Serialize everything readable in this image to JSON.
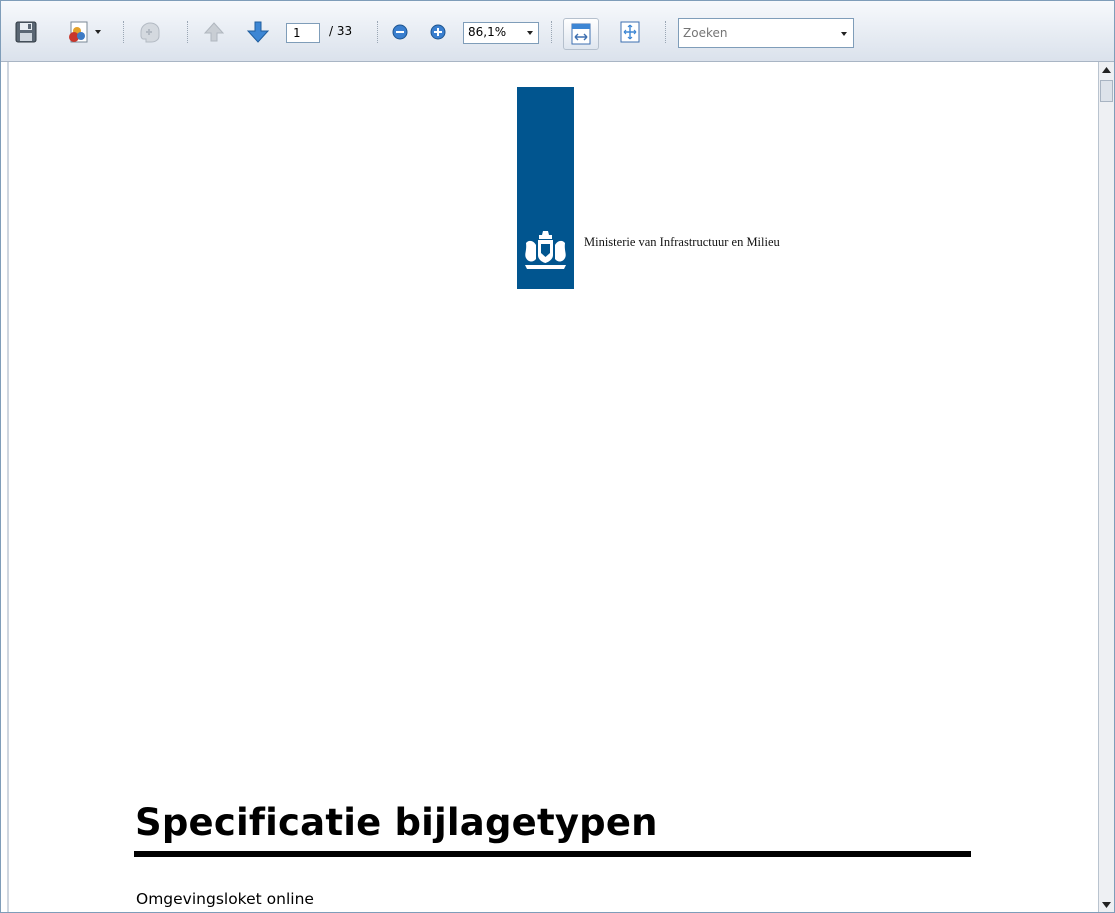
{
  "toolbar": {
    "icons": [
      "save-icon",
      "share-icon",
      "hand-tool-icon",
      "previous-page-icon",
      "next-page-icon",
      "zoom-out-icon",
      "zoom-in-icon",
      "fit-width-icon",
      "fit-page-icon",
      "dropdown-arrow-icon"
    ],
    "page_current": "1",
    "page_total": "/ 33",
    "zoom_value": "86,1%",
    "search_placeholder": "Zoeken"
  },
  "document": {
    "ministry_name": "Ministerie van Infrastructuur en Milieu",
    "title": "Specificatie bijlagetypen",
    "subtitle": "Omgevingsloket online"
  },
  "colors": {
    "logo_blue": "#01558f",
    "toolbar_bg": "#e7ecf3",
    "arrow_blue": "#3d86d4"
  }
}
